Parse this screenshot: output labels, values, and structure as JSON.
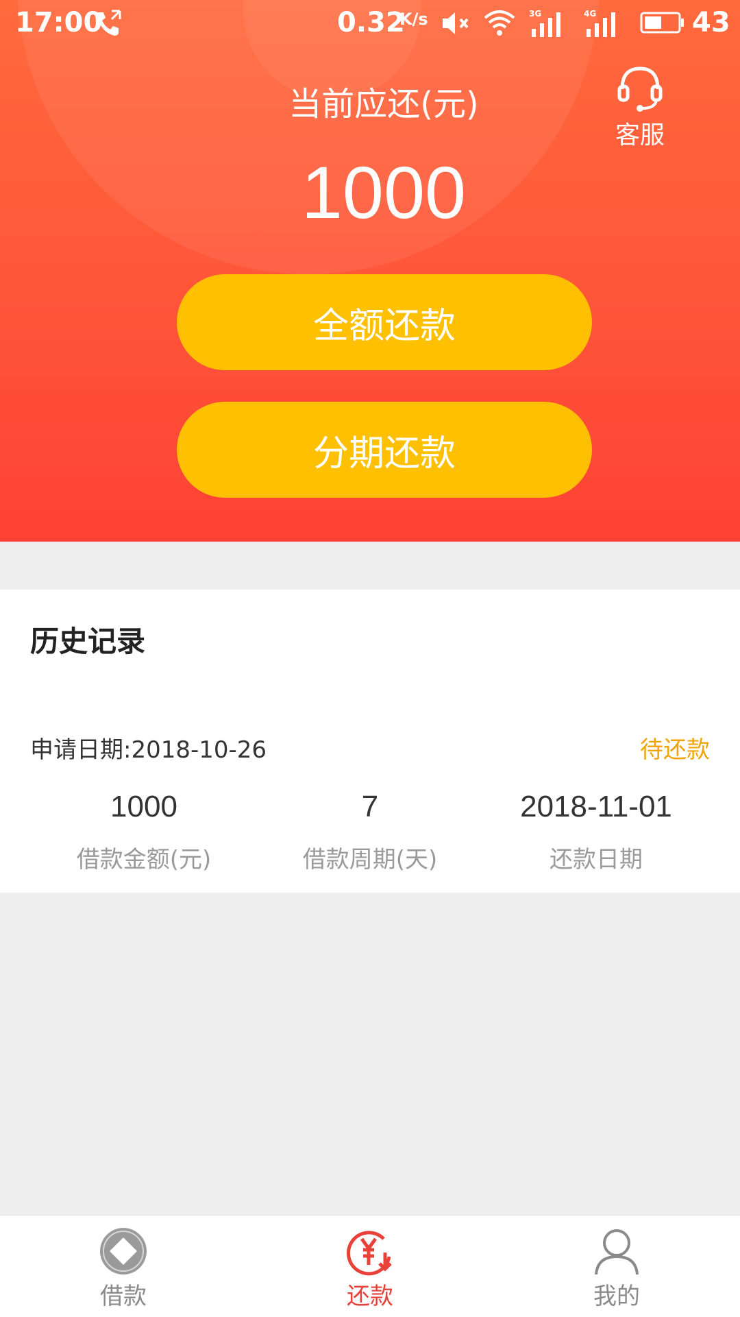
{
  "status_bar": {
    "time": "17:00",
    "speed": "0.32",
    "speed_unit": "K/s",
    "battery": "43"
  },
  "header": {
    "due_label": "当前应还(元)",
    "due_amount": "1000",
    "service_label": "客服",
    "full_repay_label": "全额还款",
    "installment_label": "分期还款"
  },
  "history": {
    "title": "历史记录",
    "apply_date": "申请日期:2018-10-26",
    "status": "待还款",
    "columns": [
      {
        "value": "1000",
        "label": "借款金额(元)"
      },
      {
        "value": "7",
        "label": "借款周期(天)"
      },
      {
        "value": "2018-11-01",
        "label": "还款日期"
      }
    ]
  },
  "nav": {
    "items": [
      {
        "label": "借款",
        "icon": "coin-diamond-icon"
      },
      {
        "label": "还款",
        "icon": "yen-repay-icon",
        "active": true
      },
      {
        "label": "我的",
        "icon": "user-icon"
      }
    ]
  },
  "colors": {
    "header_top": "#ff6a3d",
    "header_bottom": "#fe4134",
    "button": "#fec001",
    "status_pending": "#f0a30a",
    "nav_active": "#e8413a",
    "nav_inactive": "#8a8a8a"
  }
}
